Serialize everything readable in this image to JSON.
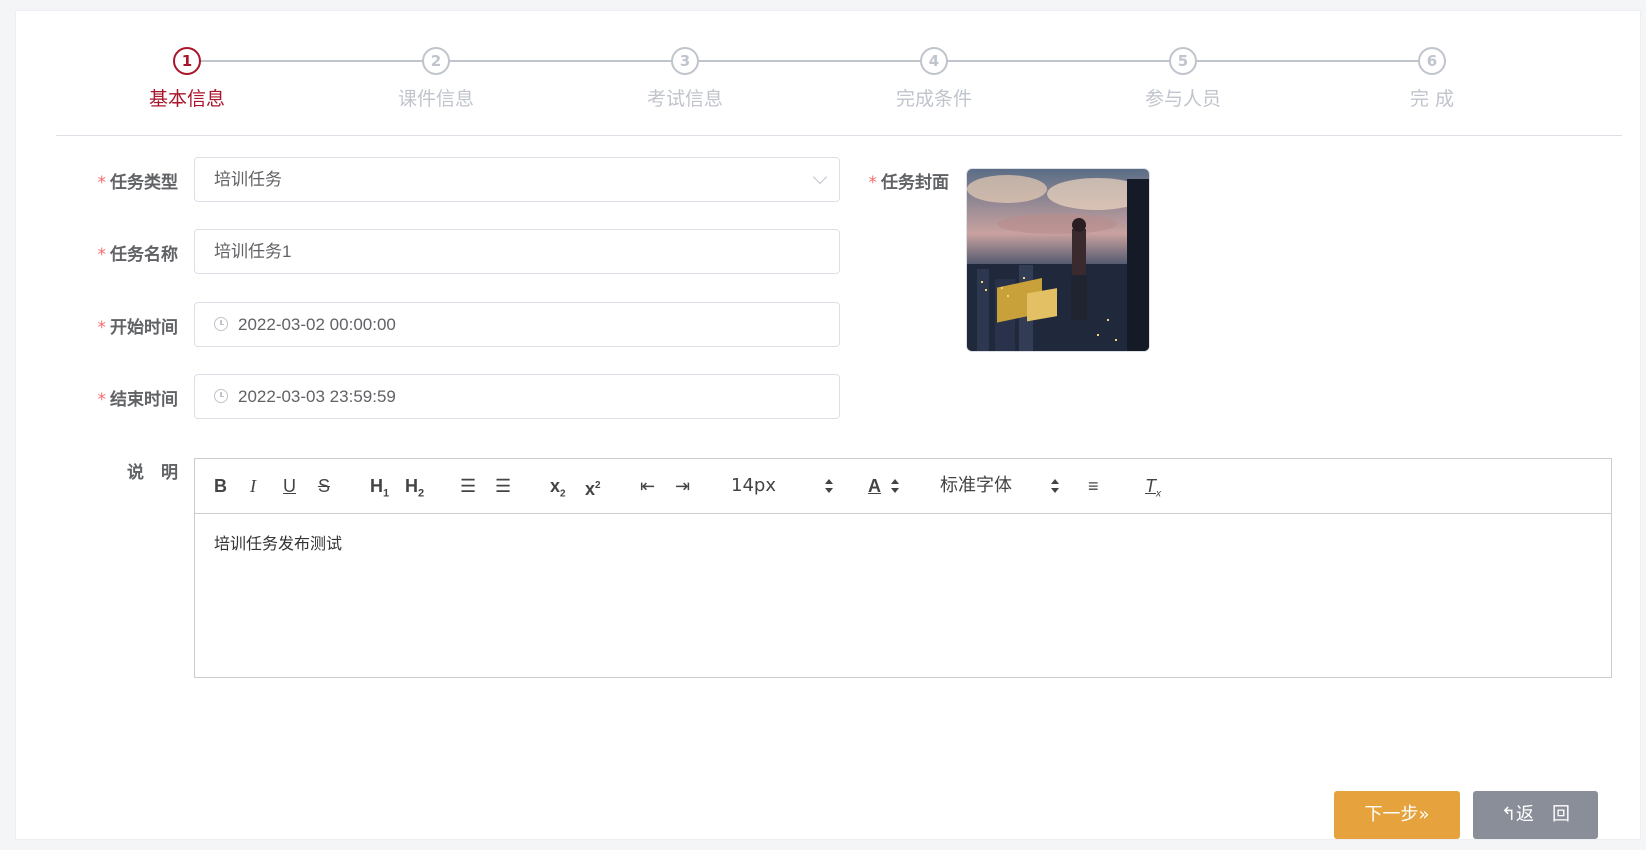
{
  "steps": [
    {
      "num": "1",
      "title": "基本信息",
      "active": true
    },
    {
      "num": "2",
      "title": "课件信息"
    },
    {
      "num": "3",
      "title": "考试信息"
    },
    {
      "num": "4",
      "title": "完成条件"
    },
    {
      "num": "5",
      "title": "参与人员"
    },
    {
      "num": "6",
      "title": "完 成"
    }
  ],
  "form": {
    "required_mark": "*",
    "task_type_label": "任务类型",
    "task_type_value": "培训任务",
    "task_name_label": "任务名称",
    "task_name_value": "培训任务1",
    "start_time_label": "开始时间",
    "start_time_value": "2022-03-02 00:00:00",
    "end_time_label": "结束时间",
    "end_time_value": "2022-03-03 23:59:59",
    "cover_label": "任务封面",
    "description_label": "说　明"
  },
  "editor": {
    "font_size": "14px",
    "font_family": "标准字体",
    "content": "培训任务发布测试"
  },
  "buttons": {
    "next_label": "下一步»",
    "back_label": "返　回"
  },
  "colors": {
    "active_step": "#a8162b",
    "next_button": "#e6a23c",
    "back_button": "#8a8e99"
  }
}
